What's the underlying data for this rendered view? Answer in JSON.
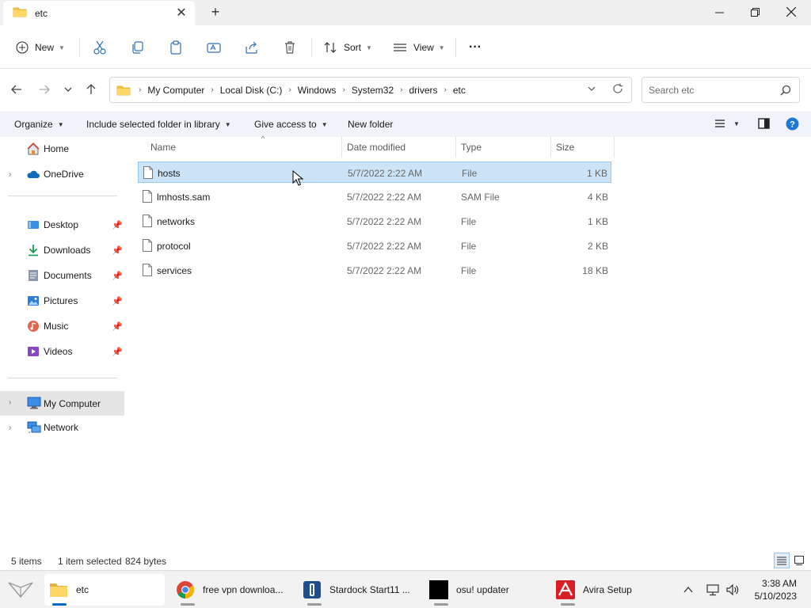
{
  "window": {
    "tab_title": "etc",
    "new_tab_symbol": "+",
    "close_tab_symbol": "✕"
  },
  "commandbar": {
    "new_label": "New",
    "sort_label": "Sort",
    "view_label": "View",
    "more_label": "···"
  },
  "address": {
    "crumbs": [
      "My Computer",
      "Local Disk (C:)",
      "Windows",
      "System32",
      "drivers",
      "etc"
    ],
    "search_placeholder": "Search etc"
  },
  "toolbar": {
    "organize": "Organize",
    "include_library": "Include selected folder in library",
    "give_access": "Give access to",
    "new_folder": "New folder"
  },
  "nav": {
    "home": "Home",
    "onedrive": "OneDrive",
    "desktop": "Desktop",
    "downloads": "Downloads",
    "documents": "Documents",
    "pictures": "Pictures",
    "music": "Music",
    "videos": "Videos",
    "mycomputer": "My Computer",
    "network": "Network"
  },
  "columns": {
    "name": "Name",
    "date": "Date modified",
    "type": "Type",
    "size": "Size"
  },
  "files": [
    {
      "name": "hosts",
      "date": "5/7/2022 2:22 AM",
      "type": "File",
      "size": "1 KB"
    },
    {
      "name": "lmhosts.sam",
      "date": "5/7/2022 2:22 AM",
      "type": "SAM File",
      "size": "4 KB"
    },
    {
      "name": "networks",
      "date": "5/7/2022 2:22 AM",
      "type": "File",
      "size": "1 KB"
    },
    {
      "name": "protocol",
      "date": "5/7/2022 2:22 AM",
      "type": "File",
      "size": "2 KB"
    },
    {
      "name": "services",
      "date": "5/7/2022 2:22 AM",
      "type": "File",
      "size": "18 KB"
    }
  ],
  "status": {
    "item_count": "5 items",
    "selection": "1 item selected",
    "selection_size": "824 bytes"
  },
  "taskbar": {
    "items": [
      {
        "label": "etc"
      },
      {
        "label": "free vpn downloa..."
      },
      {
        "label": "Stardock Start11 ..."
      },
      {
        "label": "osu! updater"
      },
      {
        "label": "Avira Setup"
      }
    ],
    "time": "3:38 AM",
    "date": "5/10/2023"
  },
  "colors": {
    "accent": "#0067c0",
    "selection_bg": "#cce4f7",
    "selection_border": "#99c9ef",
    "folder_yellow": "#f4c542"
  },
  "icons": [
    "folder-icon",
    "search-icon",
    "refresh-icon",
    "help-icon",
    "pin-icon",
    "file-icon",
    "cut-icon",
    "copy-icon",
    "paste-icon",
    "rename-icon",
    "share-icon",
    "delete-icon"
  ]
}
